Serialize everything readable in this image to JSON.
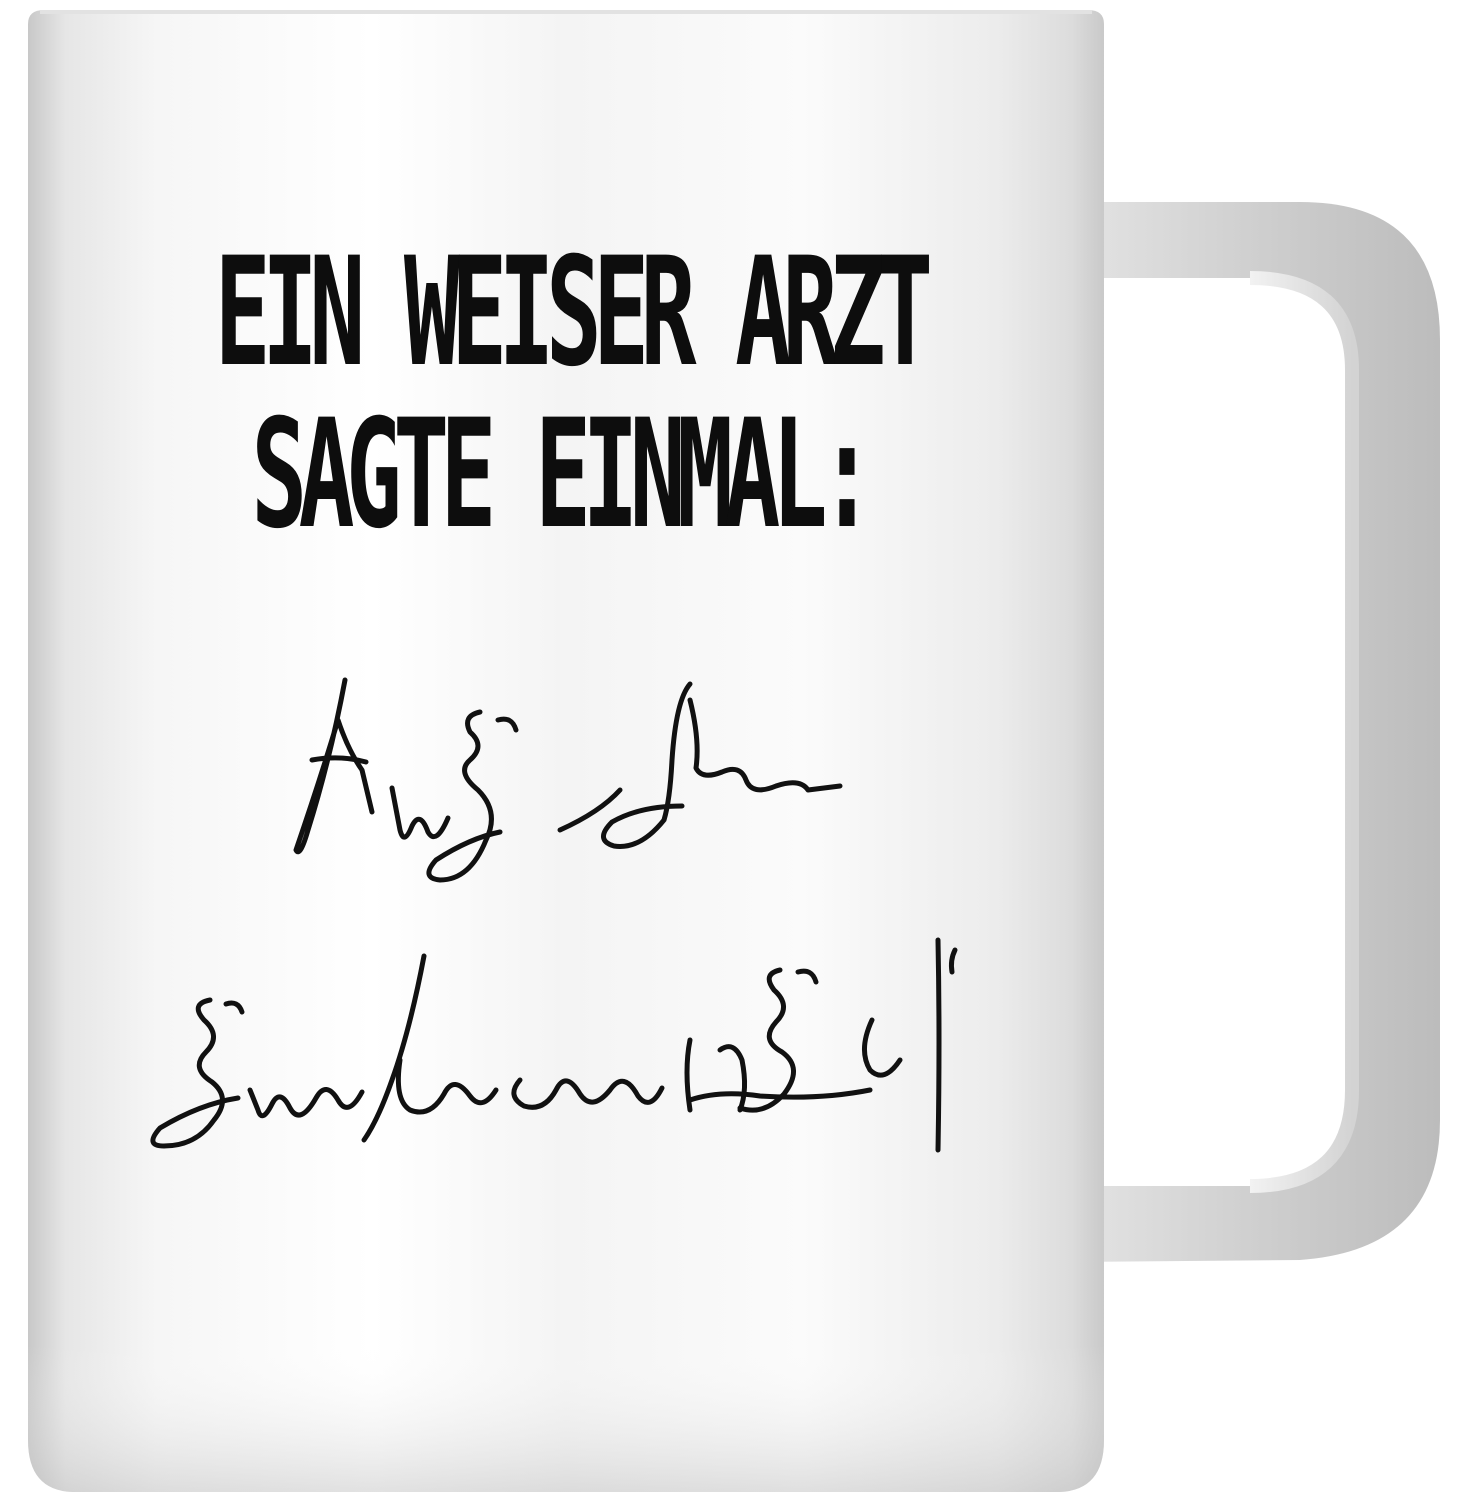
{
  "product": {
    "slogan_lines": [
      "EIN WEISER ARZT",
      "SAGTE EINMAL:"
    ],
    "signature_text": "handwritten scribble signature",
    "colors": {
      "mug_body": "#f7f7f7",
      "mug_shadow": "#c9c9c9",
      "handle": "#d6d6d6",
      "ink": "#0d0d0d",
      "background": "#ffffff"
    }
  }
}
